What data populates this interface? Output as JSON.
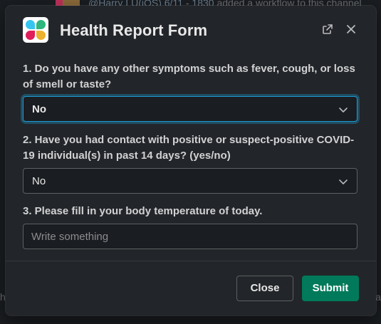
{
  "background": {
    "message_mention": "@Harry LU(iOS) 6/11 - 1830",
    "message_text": " added a workflow to this channel",
    "left_edge_text": "h",
    "right_edge_text": "a"
  },
  "modal": {
    "title": "Health Report Form",
    "app_icon": "slack-workflow-icon",
    "header_icons": [
      "open-external-icon",
      "close-icon"
    ]
  },
  "questions": [
    {
      "label": "1. Do you have any other symptoms such as fever, cough, or loss of smell or taste?",
      "type": "select",
      "selected_value": "No",
      "focused": true
    },
    {
      "label": "2. Have you had contact with positive or suspect-positive COVID-19 individual(s) in past 14 days? (yes/no)",
      "type": "select",
      "selected_value": "No",
      "focused": false
    },
    {
      "label": "3. Please fill in your body temperature of today.",
      "type": "text",
      "value": "",
      "placeholder": "Write something"
    }
  ],
  "footer": {
    "close_label": "Close",
    "submit_label": "Submit"
  },
  "colors": {
    "accent_focus": "#1d9bd1",
    "submit_green": "#007a5a",
    "modal_bg": "#222529"
  }
}
